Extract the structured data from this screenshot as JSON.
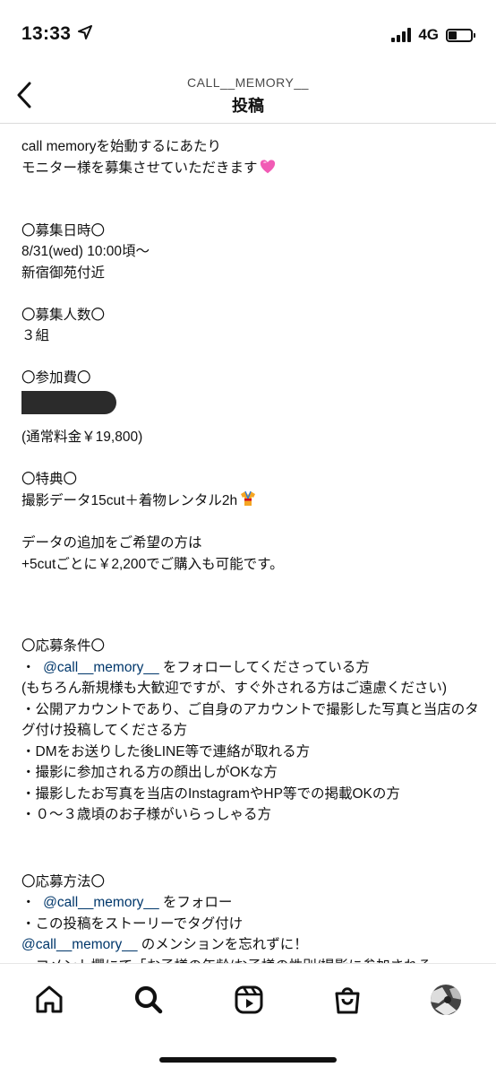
{
  "status_bar": {
    "time": "13:33",
    "network": "4G",
    "icons": [
      "location-arrow-icon",
      "signal-icon",
      "battery-icon"
    ]
  },
  "header": {
    "username": "CALL__MEMORY__",
    "title": "投稿"
  },
  "post": {
    "lines": [
      "call memoryを始動するにあたり",
      "モニター様を募集させていただきます",
      "",
      "",
      "〇募集日時〇",
      "8/31(wed) 10:00頃〜",
      "新宿御苑付近",
      "",
      "〇募集人数〇",
      "３組",
      "",
      "〇参加費〇",
      "(通常料金￥19,800)",
      "",
      "〇特典〇",
      "撮影データ15cut＋着物レンタル2h",
      "",
      "データの追加をご希望の方は",
      "+5cutごとに￥2,200でご購入も可能です。",
      "",
      "",
      "〇応募条件〇",
      "・",
      "@call__memory__",
      "をフォローしてくださっている方",
      "(もちろん新規様も大歓迎ですが、すぐ外される方はご遠慮ください)",
      "・公開アカウントであり、ご自身のアカウントで撮影した写真と当店のタグ付け投稿してくださる方",
      "・DMをお送りした後LINE等で連絡が取れる方",
      "・撮影に参加される方の顔出しがOKな方",
      "・撮影したお写真を当店のInstagramやHP等での掲載OKの方",
      "・０〜３歳頃のお子様がいらっしゃる方",
      "〇応募方法〇",
      "・",
      "@call__memory__",
      "をフォロー",
      "・この投稿をストーリーでタグ付け",
      "@call__memory__",
      "のメンションを忘れずに！",
      "・コメント欄にて「お子様の年齢/お子様の性別/撮影に参加される"
    ],
    "emoji": {
      "heart": "pink-heart-emoji",
      "kimono": "kimono-emoji"
    },
    "redacted_fee": true
  },
  "bottom_nav": {
    "items": [
      "home-icon",
      "search-icon",
      "reels-icon",
      "shop-icon",
      "profile-avatar"
    ]
  },
  "colors": {
    "mention": "#00376b",
    "text": "#111111",
    "divider": "#dbdbdb"
  }
}
